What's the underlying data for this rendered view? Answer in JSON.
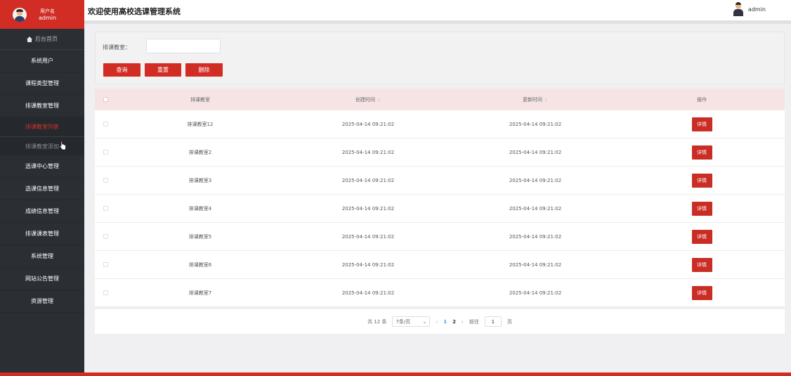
{
  "header": {
    "title": "欢迎使用高校选课管理系统",
    "user": "admin"
  },
  "sidebar": {
    "user_label": "用户名",
    "user_name": "admin",
    "home": "后台首页",
    "items": [
      {
        "label": "系统用户"
      },
      {
        "label": "课程类型管理"
      },
      {
        "label": "排课教室管理"
      }
    ],
    "sub_items": [
      {
        "label": "排课教室列表"
      },
      {
        "label": "排课教室添加"
      }
    ],
    "items_after": [
      {
        "label": "选课中心管理"
      },
      {
        "label": "选课信息管理"
      },
      {
        "label": "成绩信息管理"
      },
      {
        "label": "排课课表管理"
      },
      {
        "label": "系统管理"
      },
      {
        "label": "网站公告管理"
      },
      {
        "label": "资源管理"
      }
    ]
  },
  "search": {
    "label": "排课教室：",
    "placeholder": "",
    "buttons": {
      "query": "查询",
      "reset": "重置",
      "delete": "删除"
    }
  },
  "table": {
    "columns": {
      "name": "排课教室",
      "created": "创建时间",
      "updated": "更新时间",
      "ops": "操作"
    },
    "detail_label": "详情",
    "rows": [
      {
        "name": "排课教室12",
        "created": "2025-04-14 09:21:02",
        "updated": "2025-04-14 09:21:02"
      },
      {
        "name": "排课教室2",
        "created": "2025-04-14 09:21:02",
        "updated": "2025-04-14 09:21:02"
      },
      {
        "name": "排课教室3",
        "created": "2025-04-14 09:21:02",
        "updated": "2025-04-14 09:21:02"
      },
      {
        "name": "排课教室4",
        "created": "2025-04-14 09:21:02",
        "updated": "2025-04-14 09:21:02"
      },
      {
        "name": "排课教室5",
        "created": "2025-04-14 09:21:02",
        "updated": "2025-04-14 09:21:02"
      },
      {
        "name": "排课教室6",
        "created": "2025-04-14 09:21:02",
        "updated": "2025-04-14 09:21:02"
      },
      {
        "name": "排课教室7",
        "created": "2025-04-14 09:21:02",
        "updated": "2025-04-14 09:21:02"
      }
    ]
  },
  "pager": {
    "total": "共 12 条",
    "page_size": "7条/页",
    "pages": [
      "1",
      "2"
    ],
    "current": "1",
    "goto_label": "前往",
    "goto_value": "1",
    "page_unit": "页"
  },
  "colors": {
    "brand": "#d12d25",
    "sidebar": "#2b2e33",
    "active_sub": "#d4322b",
    "pager_current": "#409eff"
  }
}
